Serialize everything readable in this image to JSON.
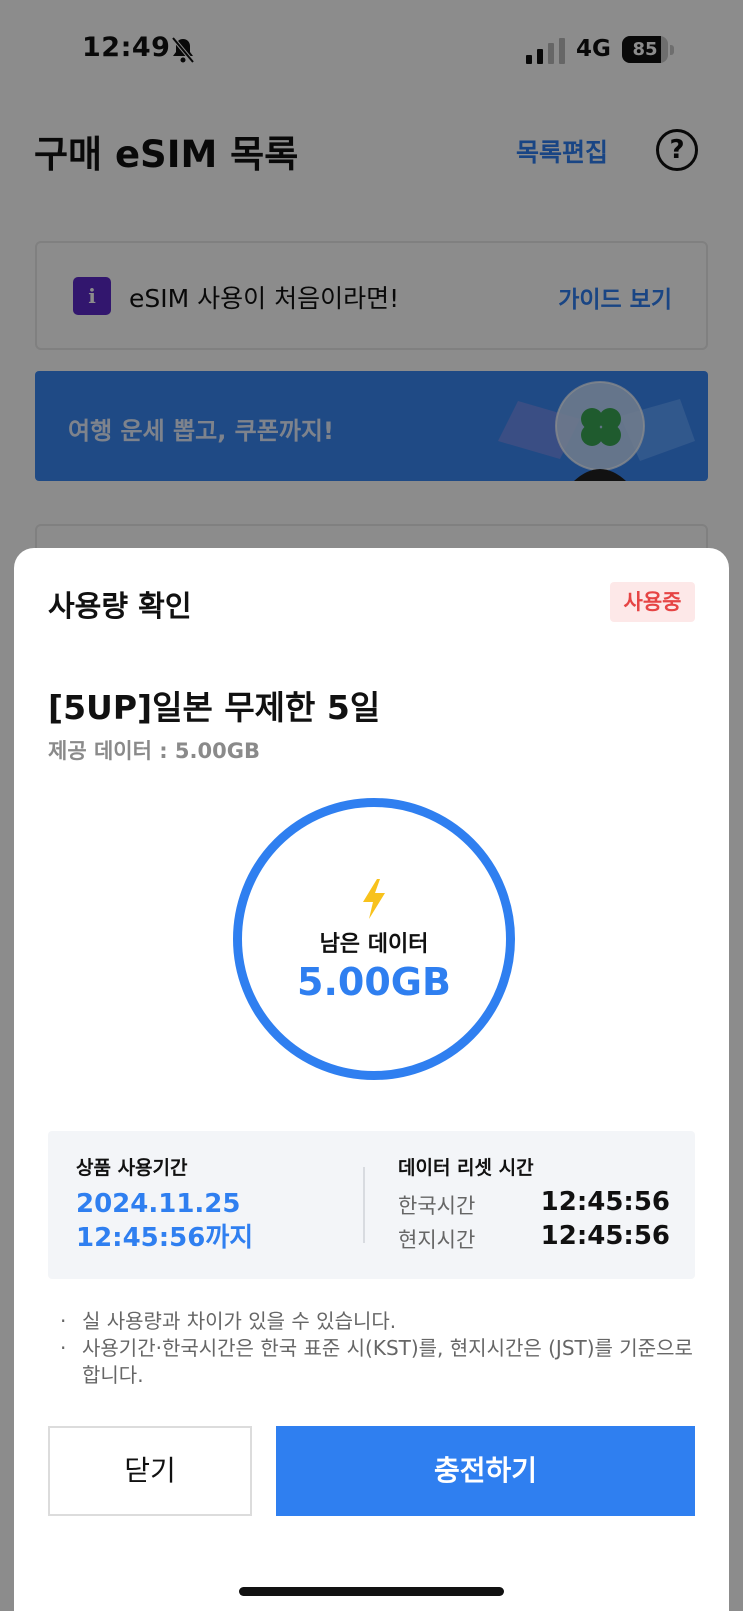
{
  "status_bar": {
    "time": "12:49",
    "network": "4G",
    "battery_label": "85",
    "battery_level": 0.85
  },
  "header": {
    "title": "구매 eSIM 목록",
    "edit_label": "목록편집",
    "help_label": "?"
  },
  "guide_card": {
    "icon_label": "i",
    "text": "eSIM 사용이 처음이라면!",
    "link_label": "가이드 보기"
  },
  "banner": {
    "text": "여행 운세 뽑고, 쿠폰까지!"
  },
  "sheet": {
    "title": "사용량 확인",
    "status_badge": "사용중",
    "product_name": "[5UP]일본 무제한 5일",
    "data_provided": "제공 데이터 : 5.00GB",
    "gauge": {
      "label": "남은 데이터",
      "value": "5.00GB"
    },
    "usage_period": {
      "label": "상품 사용기간",
      "date": "2024.11.25",
      "until": "12:45:56까지"
    },
    "data_reset": {
      "label": "데이터 리셋 시간",
      "rows": [
        {
          "name": "한국시간",
          "time": "12:45:56"
        },
        {
          "name": "현지시간",
          "time": "12:45:56"
        }
      ]
    },
    "notes": [
      "실 사용량과 차이가 있을 수 있습니다.",
      "사용기간·한국시간은 한국 표준 시(KST)를, 현지시간은 (JST)를 기준으로 합니다."
    ],
    "close_label": "닫기",
    "charge_label": "충전하기"
  },
  "colors": {
    "accent": "#2f7ff0",
    "badge_text": "#e64545",
    "badge_bg": "#fde8e8",
    "info_icon": "#5b28c9"
  }
}
